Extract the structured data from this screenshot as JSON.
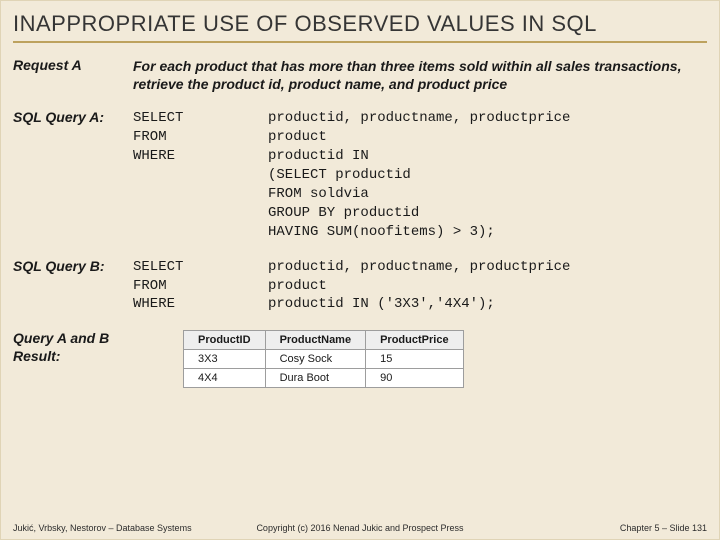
{
  "title": "INAPPROPRIATE USE OF OBSERVED VALUES IN SQL",
  "request": {
    "label": "Request A",
    "text": "For each product that has more than three items sold within all sales transactions, retrieve the product id, product name, and product price"
  },
  "queryA": {
    "label": "SQL Query A:",
    "kw1": "SELECT",
    "v1": "productid, productname, productprice",
    "kw2": "FROM",
    "v2": "product",
    "kw3": "WHERE",
    "v3": "productid IN",
    "v4": "(SELECT productid",
    "v5": "FROM soldvia",
    "v6": "GROUP BY productid",
    "v7": "HAVING SUM(noofitems) > 3);"
  },
  "queryB": {
    "label": "SQL Query B:",
    "kw1": "SELECT",
    "v1": "productid, productname, productprice",
    "kw2": "FROM",
    "v2": "product",
    "kw3": "WHERE",
    "v3": "productid IN ('3X3','4X4');"
  },
  "resultLabel": "Query A and B Result:",
  "resultTable": {
    "headers": [
      "ProductID",
      "ProductName",
      "ProductPrice"
    ],
    "rows": [
      [
        "3X3",
        "Cosy Sock",
        "15"
      ],
      [
        "4X4",
        "Dura Boot",
        "90"
      ]
    ]
  },
  "footer": {
    "left": "Jukić, Vrbsky, Nestorov – Database Systems",
    "center": "Copyright (c) 2016 Nenad Jukic and Prospect Press",
    "right": "Chapter 5 – Slide 131"
  }
}
